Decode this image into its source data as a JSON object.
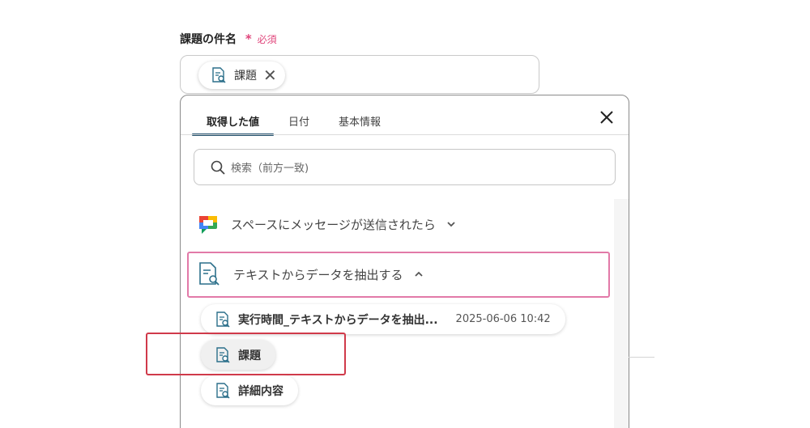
{
  "field": {
    "label": "課題の件名",
    "required_mark": "*",
    "required_text": "必須",
    "chip_label": "課題"
  },
  "panel": {
    "tabs": [
      {
        "label": "取得した値",
        "active": true
      },
      {
        "label": "日付",
        "active": false
      },
      {
        "label": "基本情報",
        "active": false
      }
    ],
    "search_placeholder": "検索（前方一致)",
    "groups": [
      {
        "title": "スペースにメッセージが送信されたら",
        "icon": "google-chat-icon",
        "expanded": false
      },
      {
        "title": "テキストからデータを抽出する",
        "icon": "document-search-icon",
        "expanded": true
      }
    ],
    "items": [
      {
        "label": "実行時間_テキストからデータを抽出...",
        "value": "2025-06-06 10:42"
      },
      {
        "label": "課題",
        "value": ""
      },
      {
        "label": "詳細内容",
        "value": ""
      }
    ]
  },
  "colors": {
    "accent": "#1f4e6b",
    "required": "#e0457b",
    "group_highlight": "#e27aa8",
    "annotation": "#d03a4a"
  }
}
